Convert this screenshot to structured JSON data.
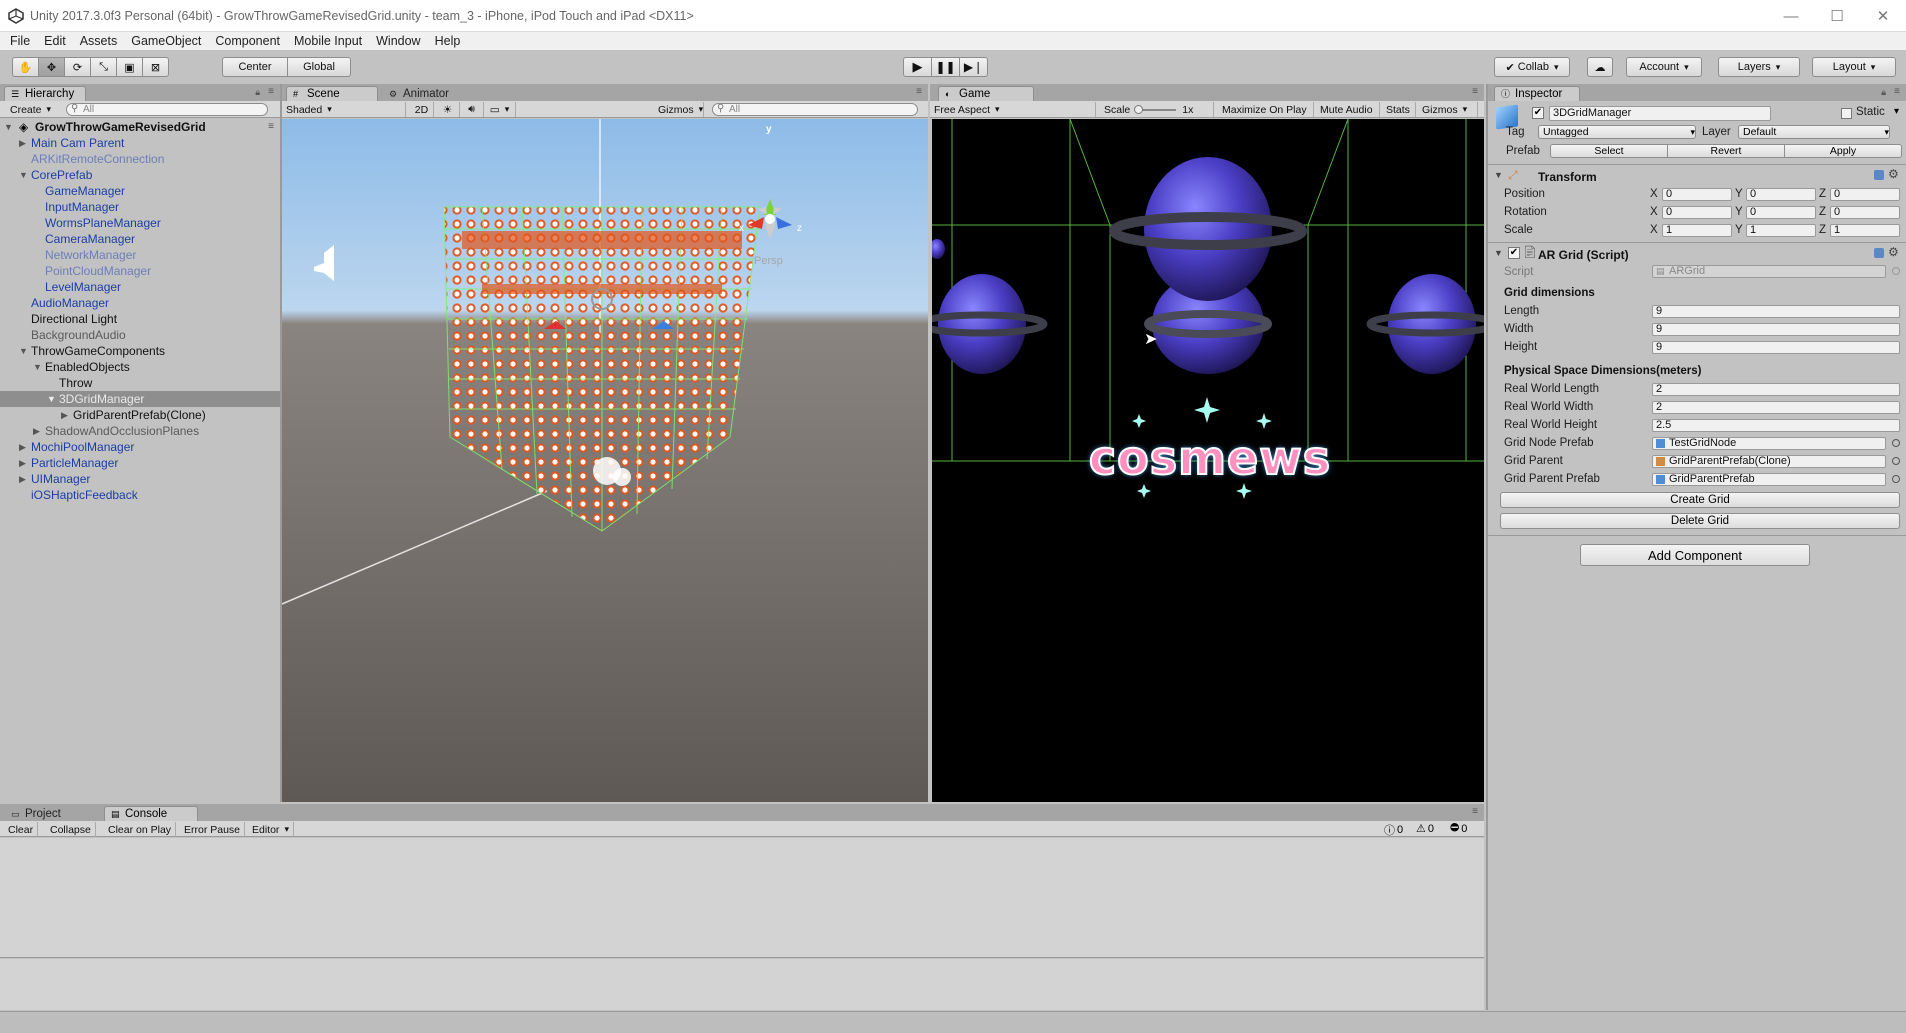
{
  "window": {
    "title": "Unity 2017.3.0f3 Personal (64bit) - GrowThrowGameRevisedGrid.unity - team_3 - iPhone, iPod Touch and iPad <DX11>",
    "minimize": "—",
    "maximize": "☐",
    "close": "✕"
  },
  "menu": [
    "File",
    "Edit",
    "Assets",
    "GameObject",
    "Component",
    "Mobile Input",
    "Window",
    "Help"
  ],
  "toolbar": {
    "pivot": "Center",
    "space": "Global",
    "collab": "Collab",
    "account": "Account",
    "layers": "Layers",
    "layout": "Layout"
  },
  "hierarchy": {
    "tab": "Hierarchy",
    "create": "Create",
    "search_placeholder": "All",
    "scene": "GrowThrowGameRevisedGrid",
    "items": [
      {
        "label": "Main Cam Parent"
      },
      {
        "label": "ARKitRemoteConnection"
      },
      {
        "label": "CorePrefab"
      },
      {
        "label": "GameManager"
      },
      {
        "label": "InputManager"
      },
      {
        "label": "WormsPlaneManager"
      },
      {
        "label": "CameraManager"
      },
      {
        "label": "NetworkManager"
      },
      {
        "label": "PointCloudManager"
      },
      {
        "label": "LevelManager"
      },
      {
        "label": "AudioManager"
      },
      {
        "label": "Directional Light"
      },
      {
        "label": "BackgroundAudio"
      },
      {
        "label": "ThrowGameComponents"
      },
      {
        "label": "EnabledObjects"
      },
      {
        "label": "Throw"
      },
      {
        "label": "3DGridManager"
      },
      {
        "label": "GridParentPrefab(Clone)"
      },
      {
        "label": "ShadowAndOcclusionPlanes"
      },
      {
        "label": "MochiPoolManager"
      },
      {
        "label": "ParticleManager"
      },
      {
        "label": "UIManager"
      },
      {
        "label": "iOSHapticFeedback"
      }
    ]
  },
  "scene": {
    "tab": "Scene",
    "tab2": "Animator",
    "shading": "Shaded",
    "mode2d": "2D",
    "gizmos": "Gizmos",
    "search_placeholder": "All",
    "persp": "Persp",
    "axis_y": "y",
    "axis_x": "x",
    "axis_z": "z"
  },
  "game": {
    "tab": "Game",
    "aspect": "Free Aspect",
    "scale_label": "Scale",
    "scale_value": "1x",
    "maximize": "Maximize On Play",
    "mute": "Mute Audio",
    "stats": "Stats",
    "gizmos": "Gizmos",
    "logo": "cosmews"
  },
  "inspector": {
    "tab": "Inspector",
    "name": "3DGridManager",
    "static": "Static",
    "tag_label": "Tag",
    "tag_value": "Untagged",
    "layer_label": "Layer",
    "layer_value": "Default",
    "prefab_label": "Prefab",
    "select": "Select",
    "revert": "Revert",
    "apply": "Apply",
    "transform": {
      "title": "Transform",
      "position": "Position",
      "rotation": "Rotation",
      "scale": "Scale",
      "x": "X",
      "y": "Y",
      "z": "Z",
      "pos": [
        "0",
        "0",
        "0"
      ],
      "rot": [
        "0",
        "0",
        "0"
      ],
      "scl": [
        "1",
        "1",
        "1"
      ]
    },
    "script": {
      "title": "AR Grid (Script)",
      "script_label": "Script",
      "script_value": "ARGrid",
      "grid_dims": "Grid dimensions",
      "length_label": "Length",
      "length": "9",
      "width_label": "Width",
      "width": "9",
      "height_label": "Height",
      "height": "9",
      "phys": "Physical Space Dimensions(meters)",
      "rwl_label": "Real World Length",
      "rwl": "2",
      "rww_label": "Real World Width",
      "rww": "2",
      "rwh_label": "Real World Height",
      "rwh": "2.5",
      "node_label": "Grid Node Prefab",
      "node": "TestGridNode",
      "parent_label": "Grid Parent",
      "parent": "GridParentPrefab(Clone)",
      "parent_prefab_label": "Grid Parent Prefab",
      "parent_prefab": "GridParentPrefab",
      "create": "Create Grid",
      "delete": "Delete Grid"
    },
    "add_component": "Add Component"
  },
  "console": {
    "tab_project": "Project",
    "tab_console": "Console",
    "clear": "Clear",
    "collapse": "Collapse",
    "clear_on_play": "Clear on Play",
    "error_pause": "Error Pause",
    "editor": "Editor",
    "info_count": "0",
    "warn_count": "0",
    "error_count": "0"
  }
}
